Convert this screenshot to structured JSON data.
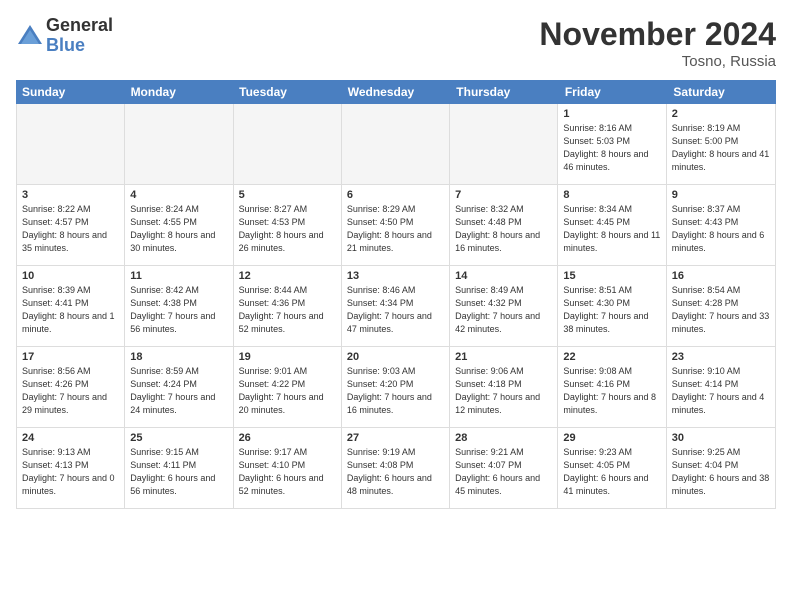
{
  "logo": {
    "general": "General",
    "blue": "Blue"
  },
  "title": "November 2024",
  "location": "Tosno, Russia",
  "days_header": [
    "Sunday",
    "Monday",
    "Tuesday",
    "Wednesday",
    "Thursday",
    "Friday",
    "Saturday"
  ],
  "weeks": [
    [
      {
        "day": "",
        "info": "",
        "empty": true
      },
      {
        "day": "",
        "info": "",
        "empty": true
      },
      {
        "day": "",
        "info": "",
        "empty": true
      },
      {
        "day": "",
        "info": "",
        "empty": true
      },
      {
        "day": "",
        "info": "",
        "empty": true
      },
      {
        "day": "1",
        "info": "Sunrise: 8:16 AM\nSunset: 5:03 PM\nDaylight: 8 hours and 46 minutes.",
        "empty": false
      },
      {
        "day": "2",
        "info": "Sunrise: 8:19 AM\nSunset: 5:00 PM\nDaylight: 8 hours and 41 minutes.",
        "empty": false
      }
    ],
    [
      {
        "day": "3",
        "info": "Sunrise: 8:22 AM\nSunset: 4:57 PM\nDaylight: 8 hours and 35 minutes.",
        "empty": false
      },
      {
        "day": "4",
        "info": "Sunrise: 8:24 AM\nSunset: 4:55 PM\nDaylight: 8 hours and 30 minutes.",
        "empty": false
      },
      {
        "day": "5",
        "info": "Sunrise: 8:27 AM\nSunset: 4:53 PM\nDaylight: 8 hours and 26 minutes.",
        "empty": false
      },
      {
        "day": "6",
        "info": "Sunrise: 8:29 AM\nSunset: 4:50 PM\nDaylight: 8 hours and 21 minutes.",
        "empty": false
      },
      {
        "day": "7",
        "info": "Sunrise: 8:32 AM\nSunset: 4:48 PM\nDaylight: 8 hours and 16 minutes.",
        "empty": false
      },
      {
        "day": "8",
        "info": "Sunrise: 8:34 AM\nSunset: 4:45 PM\nDaylight: 8 hours and 11 minutes.",
        "empty": false
      },
      {
        "day": "9",
        "info": "Sunrise: 8:37 AM\nSunset: 4:43 PM\nDaylight: 8 hours and 6 minutes.",
        "empty": false
      }
    ],
    [
      {
        "day": "10",
        "info": "Sunrise: 8:39 AM\nSunset: 4:41 PM\nDaylight: 8 hours and 1 minute.",
        "empty": false
      },
      {
        "day": "11",
        "info": "Sunrise: 8:42 AM\nSunset: 4:38 PM\nDaylight: 7 hours and 56 minutes.",
        "empty": false
      },
      {
        "day": "12",
        "info": "Sunrise: 8:44 AM\nSunset: 4:36 PM\nDaylight: 7 hours and 52 minutes.",
        "empty": false
      },
      {
        "day": "13",
        "info": "Sunrise: 8:46 AM\nSunset: 4:34 PM\nDaylight: 7 hours and 47 minutes.",
        "empty": false
      },
      {
        "day": "14",
        "info": "Sunrise: 8:49 AM\nSunset: 4:32 PM\nDaylight: 7 hours and 42 minutes.",
        "empty": false
      },
      {
        "day": "15",
        "info": "Sunrise: 8:51 AM\nSunset: 4:30 PM\nDaylight: 7 hours and 38 minutes.",
        "empty": false
      },
      {
        "day": "16",
        "info": "Sunrise: 8:54 AM\nSunset: 4:28 PM\nDaylight: 7 hours and 33 minutes.",
        "empty": false
      }
    ],
    [
      {
        "day": "17",
        "info": "Sunrise: 8:56 AM\nSunset: 4:26 PM\nDaylight: 7 hours and 29 minutes.",
        "empty": false
      },
      {
        "day": "18",
        "info": "Sunrise: 8:59 AM\nSunset: 4:24 PM\nDaylight: 7 hours and 24 minutes.",
        "empty": false
      },
      {
        "day": "19",
        "info": "Sunrise: 9:01 AM\nSunset: 4:22 PM\nDaylight: 7 hours and 20 minutes.",
        "empty": false
      },
      {
        "day": "20",
        "info": "Sunrise: 9:03 AM\nSunset: 4:20 PM\nDaylight: 7 hours and 16 minutes.",
        "empty": false
      },
      {
        "day": "21",
        "info": "Sunrise: 9:06 AM\nSunset: 4:18 PM\nDaylight: 7 hours and 12 minutes.",
        "empty": false
      },
      {
        "day": "22",
        "info": "Sunrise: 9:08 AM\nSunset: 4:16 PM\nDaylight: 7 hours and 8 minutes.",
        "empty": false
      },
      {
        "day": "23",
        "info": "Sunrise: 9:10 AM\nSunset: 4:14 PM\nDaylight: 7 hours and 4 minutes.",
        "empty": false
      }
    ],
    [
      {
        "day": "24",
        "info": "Sunrise: 9:13 AM\nSunset: 4:13 PM\nDaylight: 7 hours and 0 minutes.",
        "empty": false
      },
      {
        "day": "25",
        "info": "Sunrise: 9:15 AM\nSunset: 4:11 PM\nDaylight: 6 hours and 56 minutes.",
        "empty": false
      },
      {
        "day": "26",
        "info": "Sunrise: 9:17 AM\nSunset: 4:10 PM\nDaylight: 6 hours and 52 minutes.",
        "empty": false
      },
      {
        "day": "27",
        "info": "Sunrise: 9:19 AM\nSunset: 4:08 PM\nDaylight: 6 hours and 48 minutes.",
        "empty": false
      },
      {
        "day": "28",
        "info": "Sunrise: 9:21 AM\nSunset: 4:07 PM\nDaylight: 6 hours and 45 minutes.",
        "empty": false
      },
      {
        "day": "29",
        "info": "Sunrise: 9:23 AM\nSunset: 4:05 PM\nDaylight: 6 hours and 41 minutes.",
        "empty": false
      },
      {
        "day": "30",
        "info": "Sunrise: 9:25 AM\nSunset: 4:04 PM\nDaylight: 6 hours and 38 minutes.",
        "empty": false
      }
    ]
  ]
}
